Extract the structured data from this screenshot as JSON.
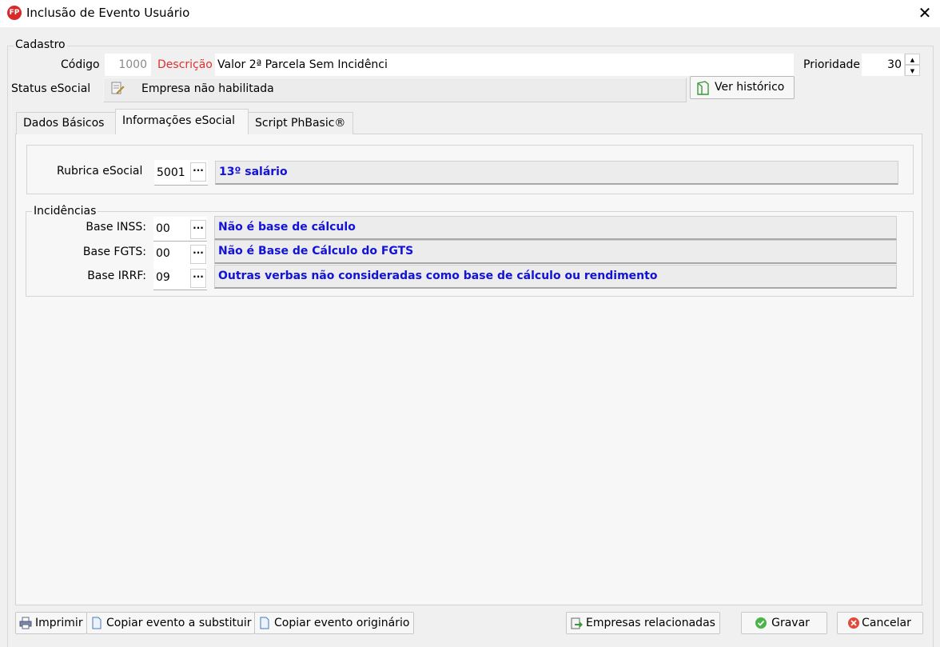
{
  "window": {
    "title": "Inclusão de Evento Usuário",
    "app_icon_text": "FP"
  },
  "cadastro": {
    "legend": "Cadastro",
    "codigo_label": "Código",
    "codigo_value": "1000",
    "descricao_label": "Descrição",
    "descricao_value": "Valor 2ª Parcela Sem Incidênci",
    "prioridade_label": "Prioridade",
    "prioridade_value": "30",
    "status_label": "Status eSocial",
    "status_value": "Empresa não habilitada",
    "ver_historico_label": "Ver histórico"
  },
  "tabs": [
    {
      "label": "Dados Básicos",
      "active": false
    },
    {
      "label": "Informações eSocial",
      "active": true
    },
    {
      "label": "Script PhBasic®",
      "active": false
    }
  ],
  "rubrica": {
    "label": "Rubrica eSocial",
    "code": "5001",
    "description": "13º salário"
  },
  "incidencias": {
    "legend": "Incidências",
    "rows": [
      {
        "label": "Base INSS:",
        "code": "00",
        "description": "Não é base de cálculo"
      },
      {
        "label": "Base FGTS:",
        "code": "00",
        "description": "Não é Base de Cálculo do FGTS"
      },
      {
        "label": "Base IRRF:",
        "code": "09",
        "description": "Outras verbas não consideradas como base de cálculo ou rendimento"
      }
    ]
  },
  "buttons": {
    "imprimir": "Imprimir",
    "copiar_substituir": "Copiar evento a substituir",
    "copiar_originario": "Copiar evento originário",
    "empresas_relacionadas": "Empresas relacionadas",
    "gravar": "Gravar",
    "cancelar": "Cancelar"
  },
  "colors": {
    "accent_red": "#e03030",
    "link_blue": "#1212d8"
  }
}
